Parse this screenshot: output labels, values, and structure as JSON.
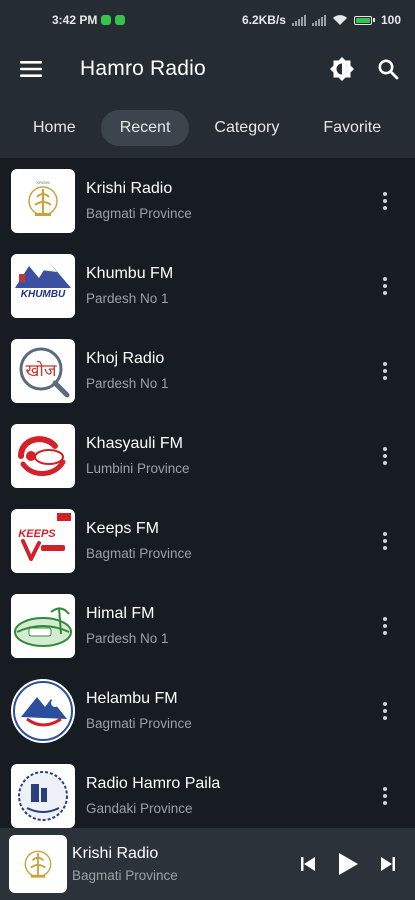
{
  "status": {
    "time": "3:42 PM",
    "speed": "6.2KB/s",
    "battery": "100",
    "battery_level": 1.0
  },
  "appbar": {
    "title": "Hamro Radio"
  },
  "tabs": [
    {
      "label": "Home"
    },
    {
      "label": "Recent"
    },
    {
      "label": "Category"
    },
    {
      "label": "Favorite"
    }
  ],
  "stations": [
    {
      "name": "Krishi Radio",
      "region": "Bagmati Province"
    },
    {
      "name": "Khumbu FM",
      "region": "Pardesh No 1"
    },
    {
      "name": "Khoj Radio",
      "region": "Pardesh No 1"
    },
    {
      "name": "Khasyauli FM",
      "region": "Lumbini Province"
    },
    {
      "name": "Keeps FM",
      "region": "Bagmati Province"
    },
    {
      "name": "Himal FM",
      "region": "Pardesh No 1"
    },
    {
      "name": "Helambu FM",
      "region": "Bagmati Province"
    },
    {
      "name": "Radio Hamro Paila",
      "region": "Gandaki Province"
    }
  ],
  "logos": {
    "khumbu": "KHUMBU",
    "khoj": "खोज",
    "keeps": "KEEPS"
  },
  "now_playing": {
    "name": "Krishi Radio",
    "region": "Bagmati Province"
  },
  "colors": {
    "accent": "#36c54a",
    "background": "#161c22",
    "bar": "#252c33",
    "subtext": "#9aa0a6"
  }
}
